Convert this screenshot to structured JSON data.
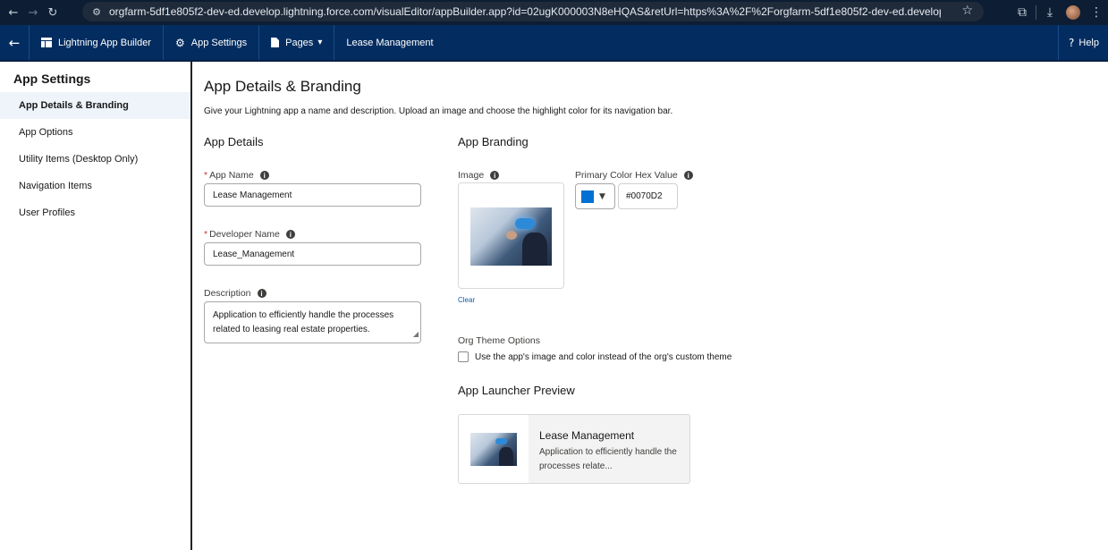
{
  "browser": {
    "url": "orgfarm-5df1e805f2-dev-ed.develop.lightning.force.com/visualEditor/appBuilder.app?id=02ugK000003N8eHQAS&retUrl=https%3A%2F%2Forgfarm-5df1e805f2-dev-ed.develop.lightning..."
  },
  "header": {
    "back_label": "←",
    "app_builder_label": "Lightning App Builder",
    "app_settings_label": "App Settings",
    "pages_label": "Pages",
    "app_name": "Lease Management",
    "help_label": "Help"
  },
  "sidebar": {
    "title": "App Settings",
    "items": [
      {
        "label": "App Details & Branding",
        "active": true
      },
      {
        "label": "App Options",
        "active": false
      },
      {
        "label": "Utility Items (Desktop Only)",
        "active": false
      },
      {
        "label": "Navigation Items",
        "active": false
      },
      {
        "label": "User Profiles",
        "active": false
      }
    ]
  },
  "main": {
    "title": "App Details & Branding",
    "description": "Give your Lightning app a name and description. Upload an image and choose the highlight color for its navigation bar.",
    "app_details": {
      "section_title": "App Details",
      "app_name_label": "App Name",
      "app_name_value": "Lease Management",
      "developer_name_label": "Developer Name",
      "developer_name_value": "Lease_Management",
      "description_label": "Description",
      "description_value": "Application to efficiently handle the processes related to leasing real estate properties."
    },
    "app_branding": {
      "section_title": "App Branding",
      "image_label": "Image",
      "clear_label": "Clear",
      "primary_color_label": "Primary Color Hex Value",
      "primary_color_value": "#0070D2",
      "swatch_color": "#0070d2"
    },
    "org_theme": {
      "label": "Org Theme Options",
      "checkbox_label": "Use the app's image and color instead of the org's custom theme",
      "checked": false
    },
    "launcher_preview": {
      "section_title": "App Launcher Preview",
      "app_name": "Lease Management",
      "app_description": "Application to efficiently handle the processes relate..."
    }
  },
  "colors": {
    "header_bg": "#032d60",
    "browser_bg": "#0d1d33",
    "link": "#0b5cab",
    "required": "#c23934"
  }
}
